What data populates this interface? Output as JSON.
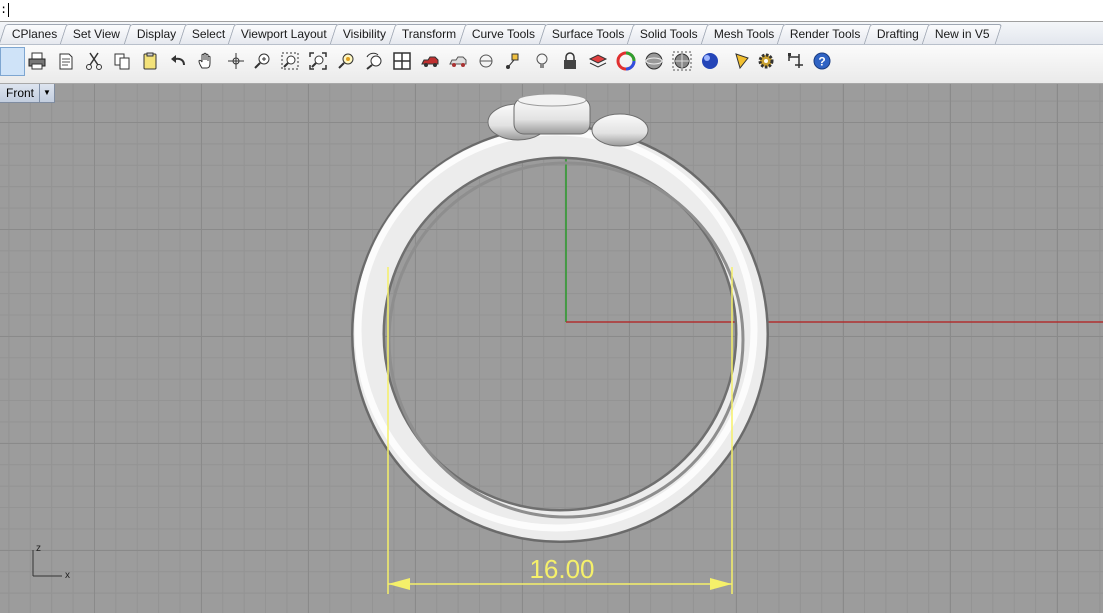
{
  "command": {
    "prompt": ":",
    "value": ""
  },
  "tabs": [
    {
      "label": "CPlanes"
    },
    {
      "label": "Set View"
    },
    {
      "label": "Display"
    },
    {
      "label": "Select"
    },
    {
      "label": "Viewport Layout"
    },
    {
      "label": "Visibility"
    },
    {
      "label": "Transform"
    },
    {
      "label": "Curve Tools"
    },
    {
      "label": "Surface Tools"
    },
    {
      "label": "Solid Tools"
    },
    {
      "label": "Mesh Tools"
    },
    {
      "label": "Render Tools"
    },
    {
      "label": "Drafting"
    },
    {
      "label": "New in V5"
    }
  ],
  "toolbar": {
    "icons": [
      "print-icon",
      "properties-icon",
      "cut-icon",
      "copy-icon",
      "paste-icon",
      "undo-icon",
      "pan-icon",
      "rotate-view-icon",
      "zoom-icon",
      "zoom-window-icon",
      "zoom-extents-icon",
      "zoom-selected-icon",
      "undo-view-icon",
      "four-viewports-icon",
      "car-icon",
      "shaded-car-icon",
      "point-icon",
      "object-snap-icon",
      "light-icon",
      "lock-icon",
      "layer-icon",
      "color-wheel-icon",
      "shaded-sphere-icon",
      "rendered-sphere-icon",
      "render-sphere-icon",
      "cone-light-icon",
      "options-gear-icon",
      "dimension-icon",
      "help-icon"
    ]
  },
  "viewport": {
    "name": "Front",
    "colors": {
      "background": "#9c9c9c",
      "grid_major": "#8a8a8a",
      "grid_minor": "#939393",
      "x_axis": "#b03030",
      "z_axis": "#2a9a2a",
      "dimension": "#f5f06a"
    },
    "axis_labels": {
      "vertical": "z",
      "horizontal": "x"
    },
    "dimension": {
      "value": "16.00"
    }
  }
}
